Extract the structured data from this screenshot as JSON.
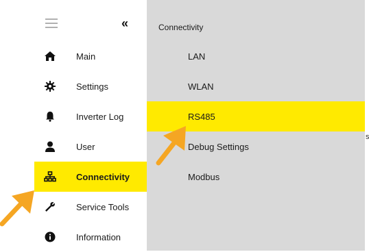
{
  "sidebar": {
    "collapse_glyph": "«",
    "items": [
      {
        "label": "Main",
        "icon": "home-icon"
      },
      {
        "label": "Settings",
        "icon": "gear-icon"
      },
      {
        "label": "Inverter Log",
        "icon": "bell-icon"
      },
      {
        "label": "User",
        "icon": "user-icon"
      },
      {
        "label": "Connectivity",
        "icon": "network-icon",
        "active": true
      },
      {
        "label": "Service Tools",
        "icon": "wrench-icon"
      },
      {
        "label": "Information",
        "icon": "info-icon"
      }
    ]
  },
  "submenu": {
    "title": "Connectivity",
    "items": [
      {
        "label": "LAN"
      },
      {
        "label": "WLAN"
      },
      {
        "label": "RS485",
        "active": true
      },
      {
        "label": "Debug Settings"
      },
      {
        "label": "Modbus"
      }
    ]
  },
  "colors": {
    "highlight": "#ffea00",
    "submenu_bg": "#d9d9d9",
    "arrow": "#f5a623"
  },
  "stray_char": "s"
}
